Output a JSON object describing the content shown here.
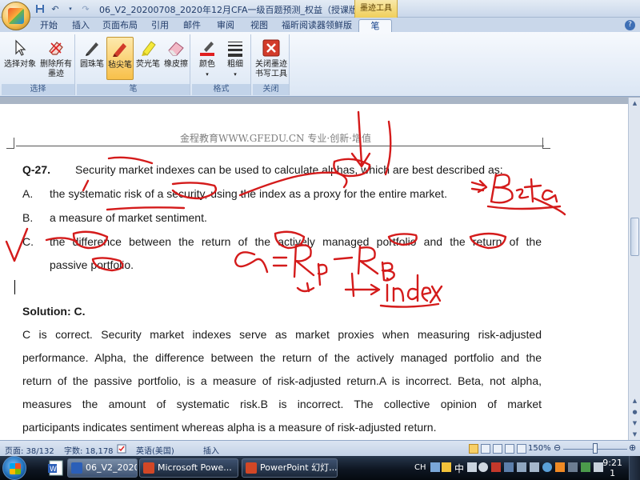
{
  "titlebar": {
    "doc_title": "06_V2_20200708_2020年12月CFA一级百题预测_权益（授课版） - Mic...",
    "context_title": "墨迹工具",
    "qat": [
      "save-icon",
      "undo-icon",
      "redo-icon"
    ]
  },
  "tabs": [
    {
      "label": "开始",
      "active": false
    },
    {
      "label": "插入",
      "active": false
    },
    {
      "label": "页面布局",
      "active": false
    },
    {
      "label": "引用",
      "active": false
    },
    {
      "label": "邮件",
      "active": false
    },
    {
      "label": "审阅",
      "active": false
    },
    {
      "label": "视图",
      "active": false
    },
    {
      "label": "福昕阅读器领鲜版",
      "active": false
    },
    {
      "label": "笔",
      "active": true
    }
  ],
  "ribbon": {
    "groups": [
      {
        "label": "选择",
        "buttons": [
          {
            "label": "选择对象",
            "icon": "arrow-cursor-icon"
          },
          {
            "label": "删除所有墨迹",
            "icon": "eraser-delete-icon"
          }
        ]
      },
      {
        "label": "笔",
        "buttons": [
          {
            "label": "圆珠笔",
            "icon": "ballpoint-pen-icon"
          },
          {
            "label": "毡尖笔",
            "icon": "felt-tip-pen-icon",
            "selected": true
          },
          {
            "label": "荧光笔",
            "icon": "highlighter-icon"
          },
          {
            "label": "橡皮擦",
            "icon": "eraser-icon"
          }
        ]
      },
      {
        "label": "格式",
        "buttons": [
          {
            "label": "颜色",
            "icon": "color-icon"
          },
          {
            "label": "粗细",
            "icon": "thickness-icon"
          }
        ]
      },
      {
        "label": "关闭",
        "buttons": [
          {
            "label": "关闭墨迹书写工具",
            "icon": "close-ink-icon"
          }
        ]
      }
    ]
  },
  "document": {
    "header": "金程教育WWW.GFEDU.CN 专业·创新·增值",
    "question": {
      "label": "Q-27.",
      "text": "Security market indexes can be used to calculate alphas, which are best described as:",
      "options": [
        {
          "letter": "A.",
          "text": "the systematic risk of a security, using the index as a proxy for the entire market."
        },
        {
          "letter": "B.",
          "text": "a measure of market sentiment."
        },
        {
          "letter": "C.",
          "text_line1": "the difference between the return of the actively managed portfolio and the return of the",
          "text_line2": "passive portfolio."
        }
      ]
    },
    "solution": {
      "label": "Solution: C.",
      "lines": [
        "C is correct. Security market indexes serve as market proxies when measuring risk-adjusted",
        "performance. Alpha, the difference between the return of the actively managed portfolio and the",
        "return of the passive portfolio, is a measure of risk-adjusted return.A is incorrect. Beta, not alpha,",
        "measures the amount of systematic risk.B is incorrect. The collective opinion of market",
        "participants indicates sentiment whereas alpha is a measure of risk-adjusted return."
      ]
    },
    "ink": {
      "beta_note": "=> Beta",
      "formula_note": "α = Rp - RB",
      "index_note": "→ index",
      "pen_color": "#d41b1b"
    }
  },
  "statusbar": {
    "page": "页面: 38/132",
    "words": "字数: 18,178",
    "language": "英语(美国)",
    "mode": "插入",
    "zoom": "150%",
    "zoom_level": 0.5
  },
  "taskbar": {
    "tasks": [
      {
        "label": "06_V2_20200708...",
        "icon_color": "#2b5fb8",
        "active": true
      },
      {
        "label": "Microsoft Powe...",
        "icon_color": "#d24726",
        "active": false
      },
      {
        "label": "PowerPoint 幻灯...",
        "icon_color": "#d24726",
        "active": false
      }
    ],
    "ime": "CH",
    "ime_char": "中",
    "clock_time": "9:21",
    "clock_day": "1"
  }
}
